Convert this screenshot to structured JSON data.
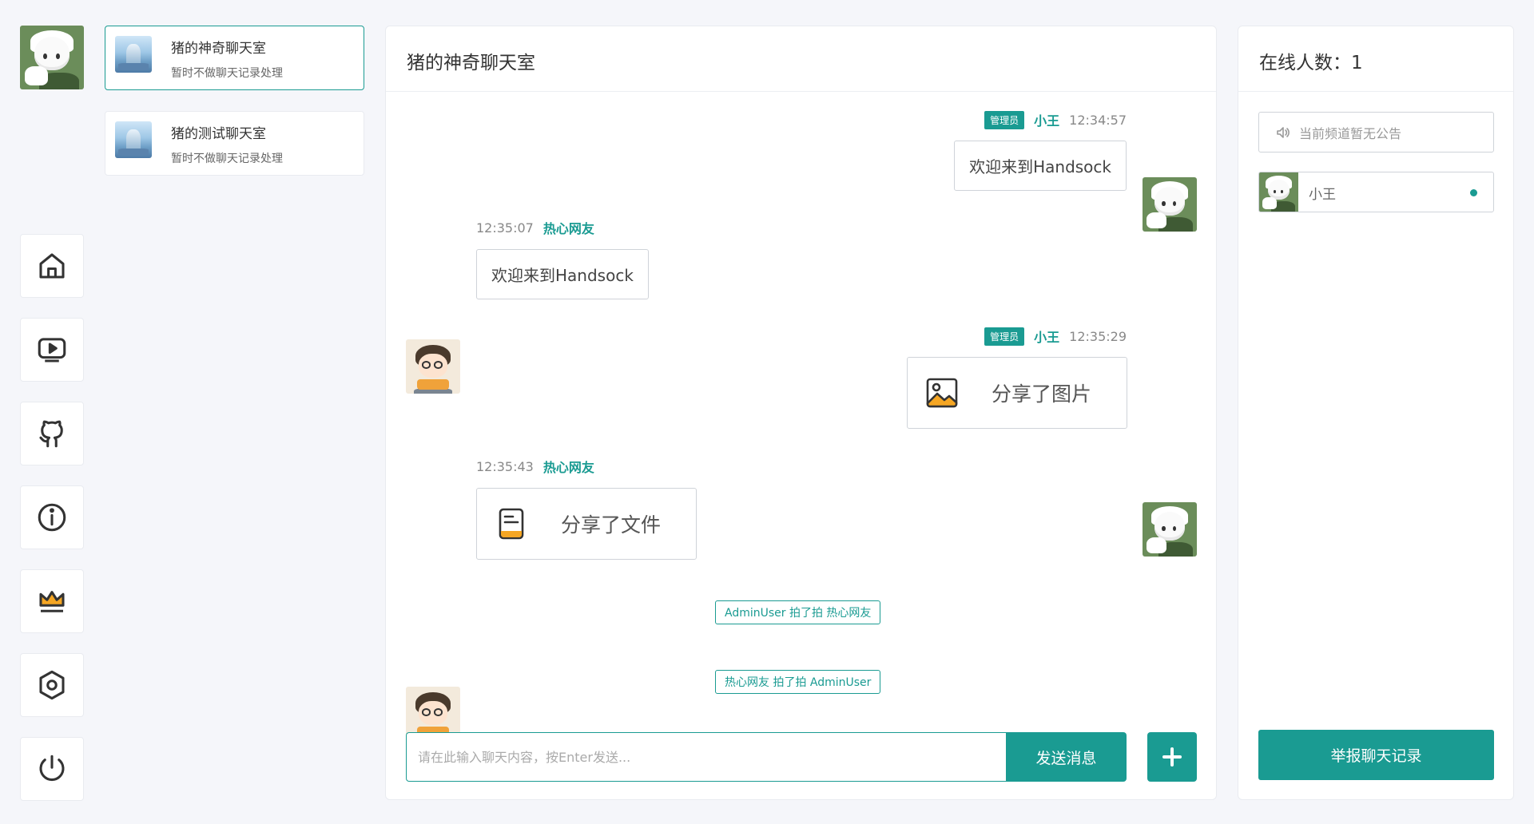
{
  "colors": {
    "accent": "#1a9b92",
    "background": "#f5f6fa",
    "crown_fill": "#f5a623"
  },
  "current_user": {
    "avatar": "admin-avatar"
  },
  "nav": [
    {
      "icon": "home-icon"
    },
    {
      "icon": "video-icon"
    },
    {
      "icon": "github-icon"
    },
    {
      "icon": "info-icon"
    },
    {
      "icon": "crown-icon"
    },
    {
      "icon": "settings-icon"
    },
    {
      "icon": "power-icon"
    }
  ],
  "rooms": [
    {
      "name": "猪的神奇聊天室",
      "desc": "暂时不做聊天记录处理",
      "active": true
    },
    {
      "name": "猪的测试聊天室",
      "desc": "暂时不做聊天记录处理",
      "active": false
    }
  ],
  "chat": {
    "title": "猪的神奇聊天室",
    "messages": [
      {
        "side": "right",
        "role": "管理员",
        "name": "小王",
        "time": "12:34:57",
        "text": "欢迎来到Handsock"
      },
      {
        "side": "left",
        "name": "热心网友",
        "time": "12:35:07",
        "text": "欢迎来到Handsock"
      },
      {
        "side": "right",
        "role": "管理员",
        "name": "小王",
        "time": "12:35:29",
        "share": "分享了图片",
        "icon": "image-icon"
      },
      {
        "side": "left",
        "name": "热心网友",
        "time": "12:35:43",
        "share": "分享了文件",
        "icon": "file-icon"
      }
    ],
    "system_tips": [
      "AdminUser 拍了拍 热心网友",
      "热心网友 拍了拍 AdminUser"
    ],
    "input_placeholder": "请在此输入聊天内容，按Enter发送...",
    "send_label": "发送消息",
    "plus_icon": "plus-icon"
  },
  "sidebar_right": {
    "online_label": "在线人数：1",
    "announcement": "当前频道暂无公告",
    "members": [
      {
        "name": "小王",
        "status": "online"
      }
    ],
    "report_label": "举报聊天记录"
  }
}
